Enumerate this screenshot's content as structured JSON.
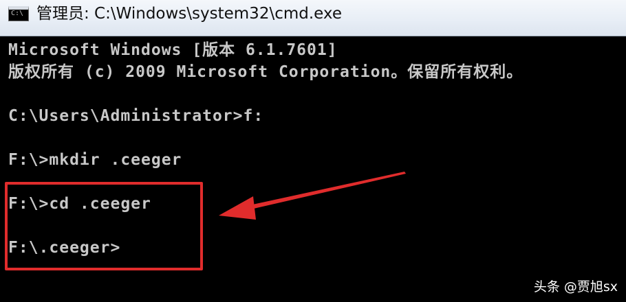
{
  "window": {
    "title": "管理员: C:\\Windows\\system32\\cmd.exe",
    "icon": "cmd-icon",
    "icon_prompt": "C:\\"
  },
  "console": {
    "lines": [
      "Microsoft Windows [版本 6.1.7601]",
      "版权所有 (c) 2009 Microsoft Corporation。保留所有权利。",
      "C:\\Users\\Administrator>f:",
      "F:\\>mkdir .ceeger",
      "F:\\>cd .ceeger",
      "F:\\.ceeger>"
    ]
  },
  "annotation": {
    "box_color": "#e02c2c",
    "arrow_color": "#e02c2c"
  },
  "watermark": {
    "text": "头条 @贾旭sx"
  }
}
